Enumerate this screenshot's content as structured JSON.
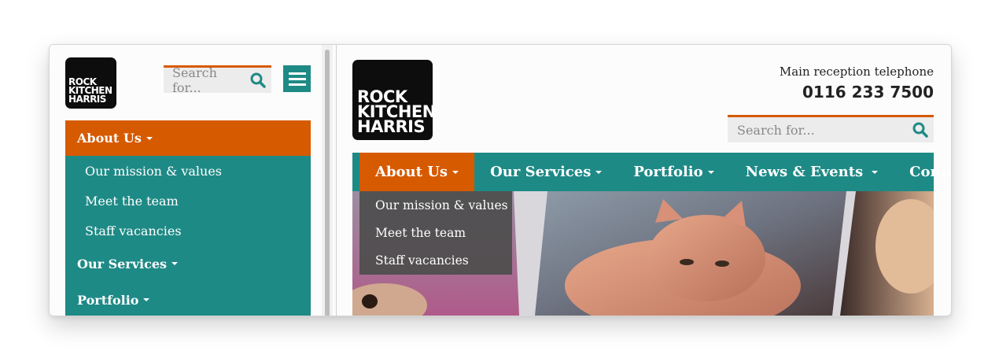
{
  "mobile": {
    "logo_lines": [
      "ROCK",
      "KITCHEN",
      "HARRIS"
    ],
    "search_placeholder": "Search for...",
    "nav": {
      "active": "About Us",
      "sub_items": [
        "Our mission & values",
        "Meet the team",
        "Staff vacancies"
      ],
      "items": [
        "Our Services",
        "Portfolio"
      ]
    }
  },
  "desktop": {
    "logo_lines": [
      "ROCK",
      "KITCHEN",
      "HARRIS"
    ],
    "tel_label": "Main reception telephone",
    "tel_number": "0116 233 7500",
    "search_placeholder": "Search for...",
    "nav": [
      "About Us",
      "Our Services",
      "Portfolio",
      "News & Events",
      "Contact"
    ],
    "dropdown": [
      "Our mission & values",
      "Meet the team",
      "Staff vacancies"
    ]
  },
  "colors": {
    "teal": "#1e8a86",
    "orange": "#d65a00",
    "logo_bg": "#0d0d0d"
  }
}
